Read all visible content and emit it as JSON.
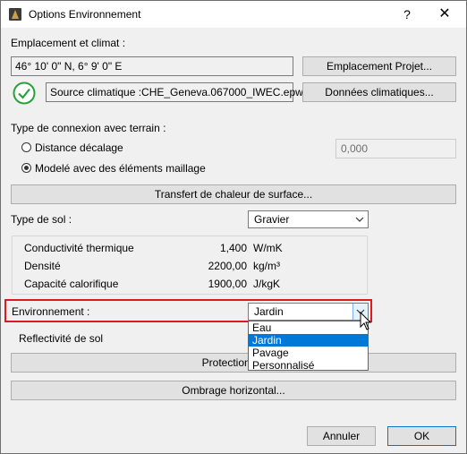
{
  "window": {
    "title": "Options Environnement",
    "help_label": "?",
    "close_label": "✕"
  },
  "location": {
    "section_label": "Emplacement et climat :",
    "coordinates": "46° 10' 0\" N, 6° 9' 0\" E",
    "project_location_button": "Emplacement Projet...",
    "climate_source": "Source climatique :CHE_Geneva.067000_IWEC.epw",
    "climate_data_button": "Données climatiques..."
  },
  "ground_connection": {
    "section_label": "Type de connexion avec terrain :",
    "option_offset": "Distance décalage",
    "option_mesh": "Modelé avec des éléments maillage",
    "selected_option": "mesh",
    "offset_value": "0,000",
    "surface_heat_button": "Transfert de chaleur de surface..."
  },
  "soil": {
    "label": "Type de sol :",
    "selected": "Gravier",
    "properties": [
      {
        "name": "Conductivité thermique",
        "value": "1,400",
        "unit": "W/mK"
      },
      {
        "name": "Densité",
        "value": "2200,00",
        "unit": "kg/m³"
      },
      {
        "name": "Capacité calorifique",
        "value": "1900,00",
        "unit": "J/kgK"
      }
    ]
  },
  "environment": {
    "label": "Environnement :",
    "selected": "Jardin",
    "options": [
      "Eau",
      "Jardin",
      "Pavage",
      "Personnalisé"
    ],
    "reflectivity_label": "Reflectivité de sol",
    "protection_button": "Protection éo",
    "horizontal_shading_button": "Ombrage horizontal..."
  },
  "footer": {
    "cancel_label": "Annuler",
    "ok_label": "OK"
  },
  "colors": {
    "highlight": "#e01a1a",
    "selection": "#0078d7",
    "check_green": "#2aa13a"
  }
}
